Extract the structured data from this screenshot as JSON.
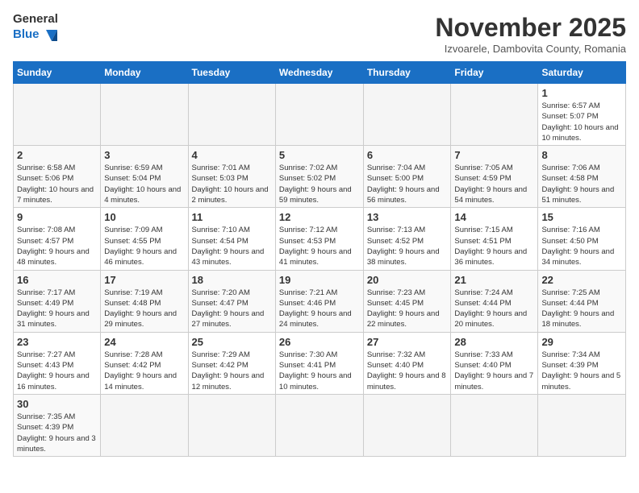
{
  "logo": {
    "line1": "General",
    "line2": "Blue"
  },
  "title": "November 2025",
  "subtitle": "Izvoarele, Dambovita County, Romania",
  "days_header": [
    "Sunday",
    "Monday",
    "Tuesday",
    "Wednesday",
    "Thursday",
    "Friday",
    "Saturday"
  ],
  "weeks": [
    [
      {
        "day": "",
        "info": ""
      },
      {
        "day": "",
        "info": ""
      },
      {
        "day": "",
        "info": ""
      },
      {
        "day": "",
        "info": ""
      },
      {
        "day": "",
        "info": ""
      },
      {
        "day": "",
        "info": ""
      },
      {
        "day": "1",
        "info": "Sunrise: 6:57 AM\nSunset: 5:07 PM\nDaylight: 10 hours and 10 minutes."
      }
    ],
    [
      {
        "day": "2",
        "info": "Sunrise: 6:58 AM\nSunset: 5:06 PM\nDaylight: 10 hours and 7 minutes."
      },
      {
        "day": "3",
        "info": "Sunrise: 6:59 AM\nSunset: 5:04 PM\nDaylight: 10 hours and 4 minutes."
      },
      {
        "day": "4",
        "info": "Sunrise: 7:01 AM\nSunset: 5:03 PM\nDaylight: 10 hours and 2 minutes."
      },
      {
        "day": "5",
        "info": "Sunrise: 7:02 AM\nSunset: 5:02 PM\nDaylight: 9 hours and 59 minutes."
      },
      {
        "day": "6",
        "info": "Sunrise: 7:04 AM\nSunset: 5:00 PM\nDaylight: 9 hours and 56 minutes."
      },
      {
        "day": "7",
        "info": "Sunrise: 7:05 AM\nSunset: 4:59 PM\nDaylight: 9 hours and 54 minutes."
      },
      {
        "day": "8",
        "info": "Sunrise: 7:06 AM\nSunset: 4:58 PM\nDaylight: 9 hours and 51 minutes."
      }
    ],
    [
      {
        "day": "9",
        "info": "Sunrise: 7:08 AM\nSunset: 4:57 PM\nDaylight: 9 hours and 48 minutes."
      },
      {
        "day": "10",
        "info": "Sunrise: 7:09 AM\nSunset: 4:55 PM\nDaylight: 9 hours and 46 minutes."
      },
      {
        "day": "11",
        "info": "Sunrise: 7:10 AM\nSunset: 4:54 PM\nDaylight: 9 hours and 43 minutes."
      },
      {
        "day": "12",
        "info": "Sunrise: 7:12 AM\nSunset: 4:53 PM\nDaylight: 9 hours and 41 minutes."
      },
      {
        "day": "13",
        "info": "Sunrise: 7:13 AM\nSunset: 4:52 PM\nDaylight: 9 hours and 38 minutes."
      },
      {
        "day": "14",
        "info": "Sunrise: 7:15 AM\nSunset: 4:51 PM\nDaylight: 9 hours and 36 minutes."
      },
      {
        "day": "15",
        "info": "Sunrise: 7:16 AM\nSunset: 4:50 PM\nDaylight: 9 hours and 34 minutes."
      }
    ],
    [
      {
        "day": "16",
        "info": "Sunrise: 7:17 AM\nSunset: 4:49 PM\nDaylight: 9 hours and 31 minutes."
      },
      {
        "day": "17",
        "info": "Sunrise: 7:19 AM\nSunset: 4:48 PM\nDaylight: 9 hours and 29 minutes."
      },
      {
        "day": "18",
        "info": "Sunrise: 7:20 AM\nSunset: 4:47 PM\nDaylight: 9 hours and 27 minutes."
      },
      {
        "day": "19",
        "info": "Sunrise: 7:21 AM\nSunset: 4:46 PM\nDaylight: 9 hours and 24 minutes."
      },
      {
        "day": "20",
        "info": "Sunrise: 7:23 AM\nSunset: 4:45 PM\nDaylight: 9 hours and 22 minutes."
      },
      {
        "day": "21",
        "info": "Sunrise: 7:24 AM\nSunset: 4:44 PM\nDaylight: 9 hours and 20 minutes."
      },
      {
        "day": "22",
        "info": "Sunrise: 7:25 AM\nSunset: 4:44 PM\nDaylight: 9 hours and 18 minutes."
      }
    ],
    [
      {
        "day": "23",
        "info": "Sunrise: 7:27 AM\nSunset: 4:43 PM\nDaylight: 9 hours and 16 minutes."
      },
      {
        "day": "24",
        "info": "Sunrise: 7:28 AM\nSunset: 4:42 PM\nDaylight: 9 hours and 14 minutes."
      },
      {
        "day": "25",
        "info": "Sunrise: 7:29 AM\nSunset: 4:42 PM\nDaylight: 9 hours and 12 minutes."
      },
      {
        "day": "26",
        "info": "Sunrise: 7:30 AM\nSunset: 4:41 PM\nDaylight: 9 hours and 10 minutes."
      },
      {
        "day": "27",
        "info": "Sunrise: 7:32 AM\nSunset: 4:40 PM\nDaylight: 9 hours and 8 minutes."
      },
      {
        "day": "28",
        "info": "Sunrise: 7:33 AM\nSunset: 4:40 PM\nDaylight: 9 hours and 7 minutes."
      },
      {
        "day": "29",
        "info": "Sunrise: 7:34 AM\nSunset: 4:39 PM\nDaylight: 9 hours and 5 minutes."
      }
    ],
    [
      {
        "day": "30",
        "info": "Sunrise: 7:35 AM\nSunset: 4:39 PM\nDaylight: 9 hours and 3 minutes."
      },
      {
        "day": "",
        "info": ""
      },
      {
        "day": "",
        "info": ""
      },
      {
        "day": "",
        "info": ""
      },
      {
        "day": "",
        "info": ""
      },
      {
        "day": "",
        "info": ""
      },
      {
        "day": "",
        "info": ""
      }
    ]
  ]
}
